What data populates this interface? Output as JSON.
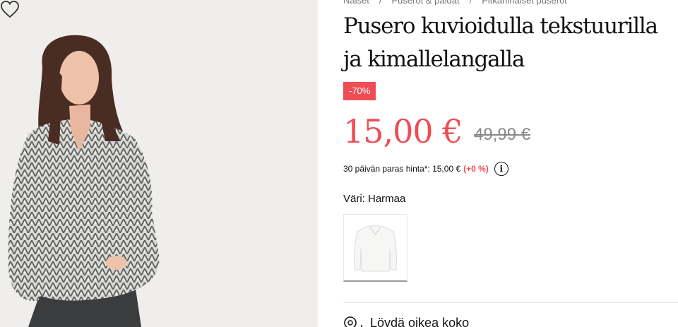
{
  "breadcrumb": [
    "Naiset",
    "Puserot & paidat",
    "Pitkähihaiset puserot"
  ],
  "breadcrumb_separator": "/",
  "product": {
    "title": "Pusero kuvioidulla tekstuurilla ja kimallelangalla",
    "discount_badge": "-70%",
    "price": "15,00 €",
    "original_price": "49,99 €",
    "lowest_price_text": "30 päivän paras hinta*: 15,00 €",
    "lowest_price_change": "(+0 %)",
    "color_label": "Väri: Harmaa",
    "size_guide": "Löydä oikea koko"
  },
  "icons": {
    "wishlist": "heart-outline-icon",
    "info": "info-circle-icon",
    "size_guide": "measuring-tape-icon"
  },
  "colors": {
    "sale": "#ef4d54",
    "text": "#111111",
    "muted": "#777777",
    "image_background": "#efeeec"
  }
}
